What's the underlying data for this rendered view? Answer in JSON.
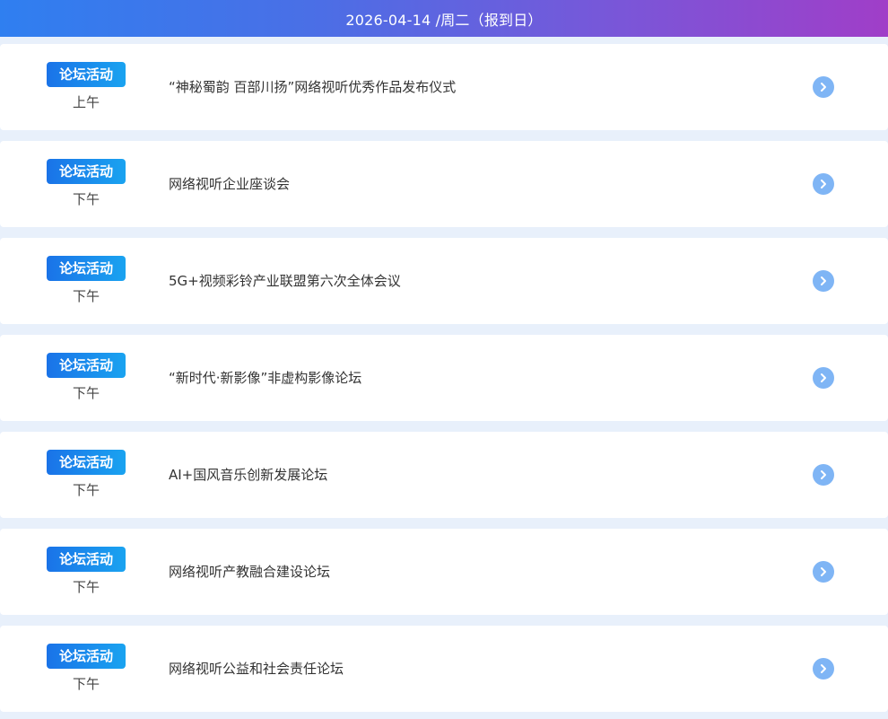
{
  "header": {
    "title": "2026-04-14 /周二（报到日）"
  },
  "events": [
    {
      "badge": "论坛活动",
      "period": "上午",
      "title": "“神秘蜀韵 百部川扬”网络视听优秀作品发布仪式"
    },
    {
      "badge": "论坛活动",
      "period": "下午",
      "title": "网络视听企业座谈会"
    },
    {
      "badge": "论坛活动",
      "period": "下午",
      "title": "5G+视频彩铃产业联盟第六次全体会议"
    },
    {
      "badge": "论坛活动",
      "period": "下午",
      "title": "“新时代·新影像”非虚构影像论坛"
    },
    {
      "badge": "论坛活动",
      "period": "下午",
      "title": "AI+国风音乐创新发展论坛"
    },
    {
      "badge": "论坛活动",
      "period": "下午",
      "title": "网络视听产教融合建设论坛"
    },
    {
      "badge": "论坛活动",
      "period": "下午",
      "title": "网络视听公益和社会责任论坛"
    }
  ],
  "icons": {
    "arrow": "chevron-right-circle-icon"
  },
  "colors": {
    "badge_start": "#1a73e8",
    "badge_end": "#1aa3f0",
    "arrow_bg": "#7fb5f5",
    "page_bg": "#e8f0fb"
  }
}
